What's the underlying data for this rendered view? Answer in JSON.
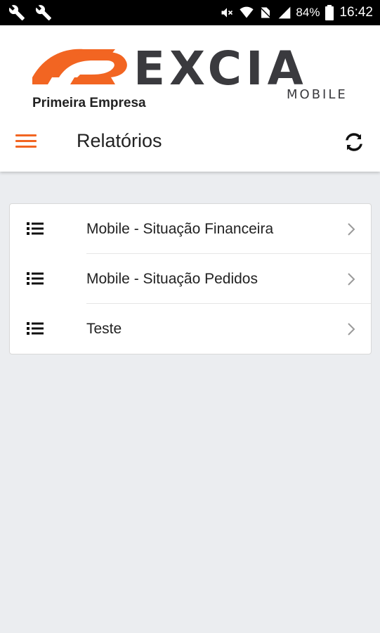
{
  "status_bar": {
    "battery": "84%",
    "time": "16:42",
    "icons": [
      "wrench-icon",
      "wrench-icon",
      "mute-icon",
      "wifi-icon",
      "no-sim-icon",
      "signal-icon",
      "battery-icon"
    ]
  },
  "header": {
    "brand": "EXCIA",
    "brand_sub": "MOBILE",
    "company": "Primeira Empresa",
    "title": "Relatórios",
    "accent_color": "#f26522",
    "brand_dark_color": "#3a3a3e"
  },
  "reports": {
    "items": [
      {
        "label": "Mobile - Situação Financeira",
        "icon": "list-icon"
      },
      {
        "label": "Mobile - Situação Pedidos",
        "icon": "list-icon"
      },
      {
        "label": "Teste",
        "icon": "list-icon"
      }
    ]
  }
}
